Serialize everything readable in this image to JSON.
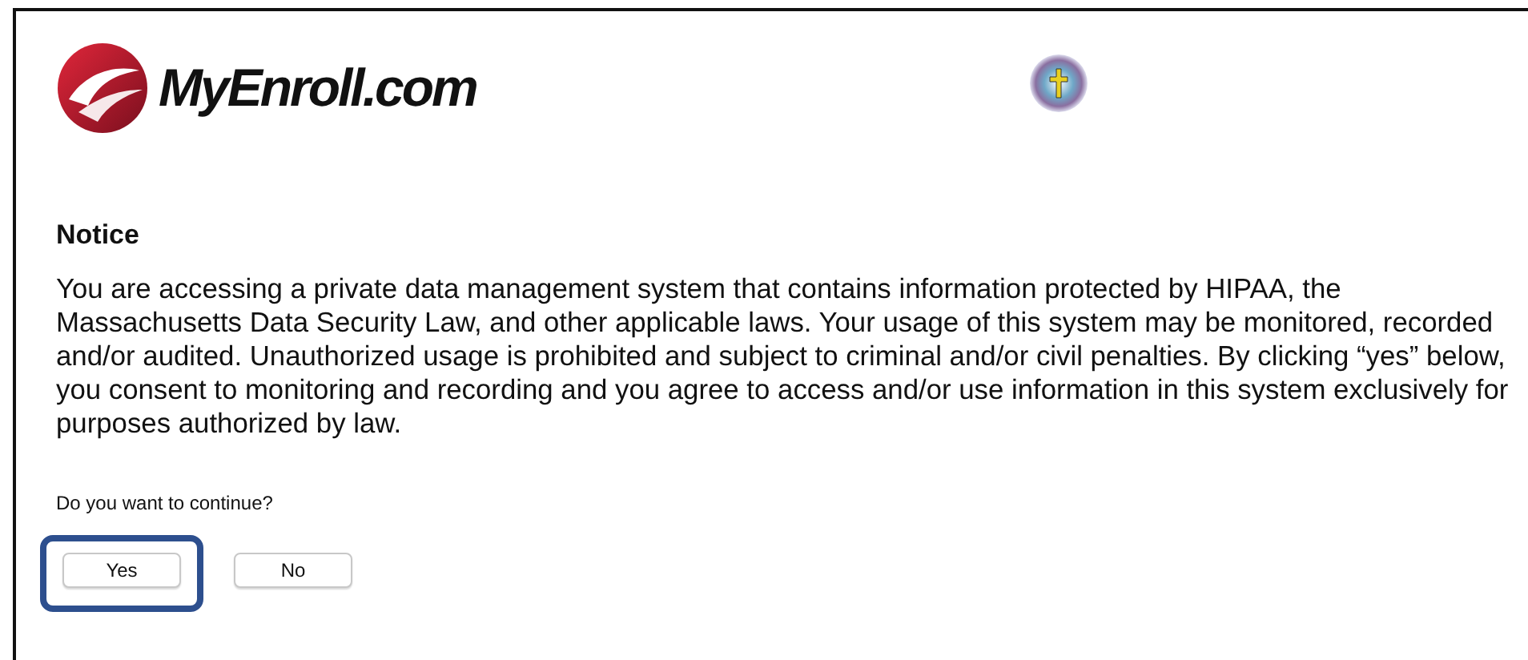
{
  "header": {
    "logo_text": "MyEnroll.com"
  },
  "notice": {
    "title": "Notice",
    "body": "You are accessing a private data management system that contains information protected by HIPAA, the Massachusetts Data Security Law, and other applicable laws. Your usage of this system may be monitored, recorded and/or audited. Unauthorized usage is prohibited and subject to criminal and/or civil penalties. By clicking “yes” below, you consent to monitoring and recording and you agree to access and/or use information in this system exclusively for purposes authorized by law."
  },
  "question": "Do you want to continue?",
  "buttons": [
    {
      "label": "Yes",
      "highlighted": true
    },
    {
      "label": "No",
      "highlighted": false
    }
  ]
}
